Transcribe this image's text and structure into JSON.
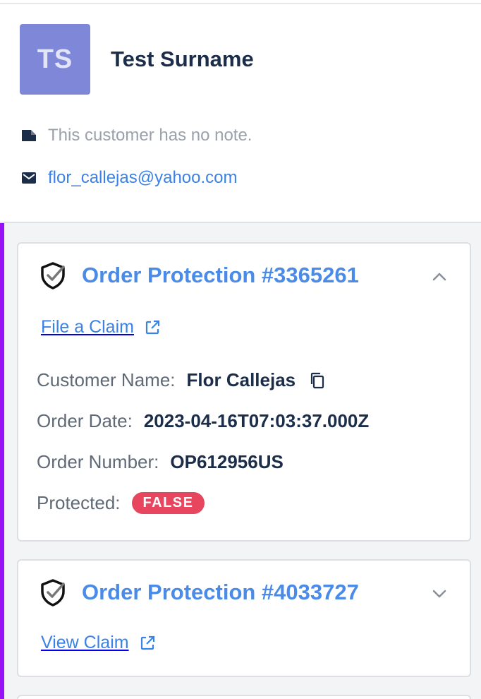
{
  "customer": {
    "initials": "TS",
    "name": "Test Surname",
    "note": "This customer has no note.",
    "email": "flor_callejas@yahoo.com"
  },
  "orders": [
    {
      "title": "Order Protection #3365261",
      "expanded": true,
      "claim_label": "File a Claim",
      "fields": {
        "customer_name_label": "Customer Name:",
        "customer_name": "Flor Callejas",
        "order_date_label": "Order Date:",
        "order_date": "2023-04-16T07:03:37.000Z",
        "order_number_label": "Order Number:",
        "order_number": "OP612956US",
        "protected_label": "Protected:",
        "protected": "FALSE"
      }
    },
    {
      "title": "Order Protection #4033727",
      "expanded": false,
      "claim_label": "View Claim"
    }
  ],
  "colors": {
    "accent_bar": "#9b11f5",
    "link": "#3b82e6",
    "badge_false": "#e8455f",
    "avatar": "#7f88d8"
  },
  "icons": [
    "note-icon",
    "email-icon",
    "shield-check-icon",
    "chevron-up-icon",
    "chevron-down-icon",
    "external-link-icon",
    "copy-icon"
  ]
}
